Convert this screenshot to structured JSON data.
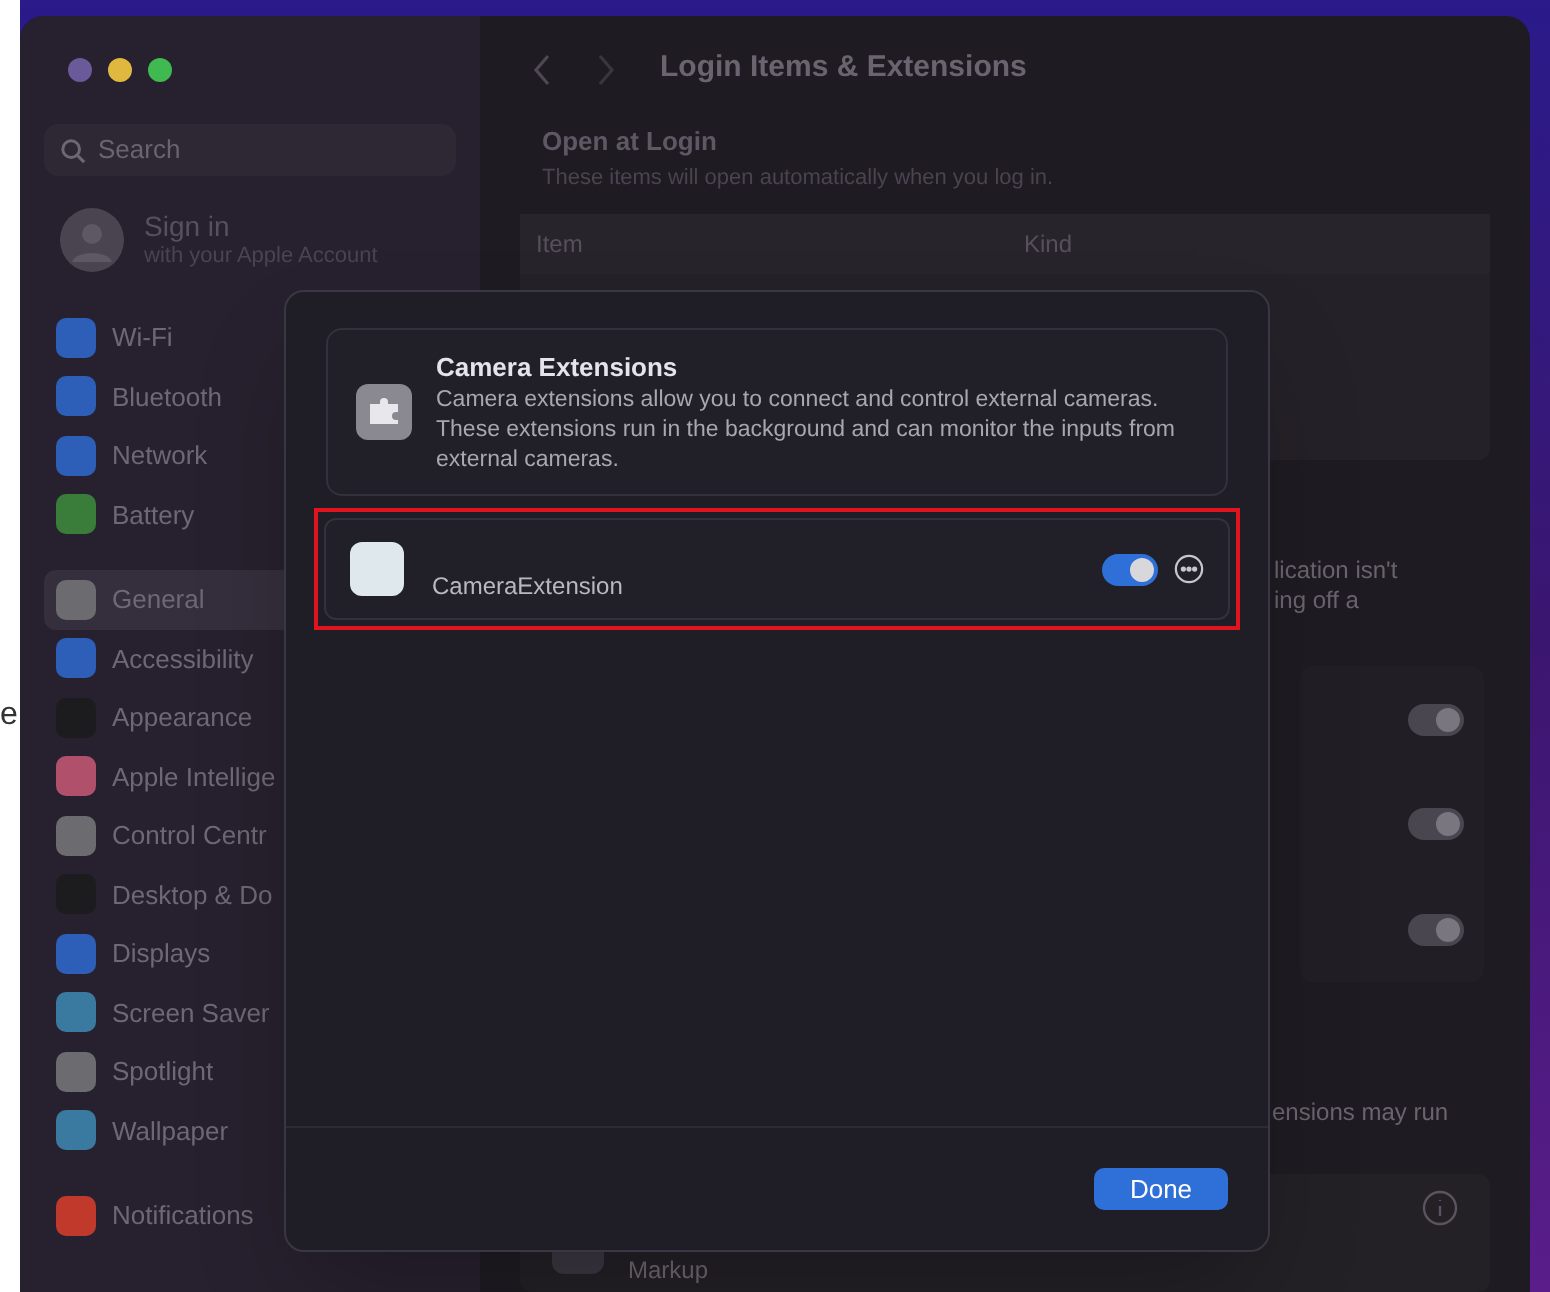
{
  "margin_text": "e",
  "sidebar": {
    "search": {
      "placeholder": "Search"
    },
    "account": {
      "title": "Sign in",
      "subtitle": "with your Apple Account"
    },
    "groups": [
      {
        "items": [
          {
            "label": "Wi-Fi",
            "selected": false,
            "color": "#2d5fb8"
          },
          {
            "label": "Bluetooth",
            "selected": false,
            "color": "#2d5fb8"
          },
          {
            "label": "Network",
            "selected": false,
            "color": "#2d5fb8"
          },
          {
            "label": "Battery",
            "selected": false,
            "color": "#3a7d3a"
          }
        ]
      },
      {
        "items": [
          {
            "label": "General",
            "selected": true,
            "color": "#6b6b70"
          },
          {
            "label": "Accessibility",
            "selected": false,
            "color": "#2d5fb8"
          },
          {
            "label": "Appearance",
            "selected": false,
            "color": "#1c1c1e"
          },
          {
            "label": "Apple Intellige",
            "selected": false,
            "color": "#b0506a"
          },
          {
            "label": "Control Centr",
            "selected": false,
            "color": "#6b6b70"
          },
          {
            "label": "Desktop & Do",
            "selected": false,
            "color": "#1c1c1e"
          },
          {
            "label": "Displays",
            "selected": false,
            "color": "#2d5fb8"
          },
          {
            "label": "Screen Saver",
            "selected": false,
            "color": "#3a7aa0"
          },
          {
            "label": "Spotlight",
            "selected": false,
            "color": "#6b6b70"
          },
          {
            "label": "Wallpaper",
            "selected": false,
            "color": "#3a7aa0"
          }
        ]
      },
      {
        "items": [
          {
            "label": "Notifications",
            "selected": false,
            "color": "#c0392b"
          }
        ]
      }
    ]
  },
  "content": {
    "title": "Login Items & Extensions",
    "section": {
      "title": "Open at Login",
      "subtitle": "These items will open automatically when you log in."
    },
    "table": {
      "columns": [
        "Item",
        "Kind"
      ]
    },
    "fragment_lines": [
      "lication isn't",
      "ing off a"
    ],
    "toggles": [
      {
        "on": true
      },
      {
        "on": true
      },
      {
        "on": true
      }
    ],
    "note_fragment": "ensions may run",
    "bottom_row": {
      "label": "Markup"
    }
  },
  "dialog": {
    "header": {
      "title": "Camera Extensions",
      "description": "Camera extensions allow you to connect and control external cameras. These extensions run in the background and can monitor the inputs from external cameras."
    },
    "extensions": [
      {
        "name": "CameraExtension",
        "on": true,
        "highlighted": true
      }
    ],
    "done_button": "Done"
  }
}
